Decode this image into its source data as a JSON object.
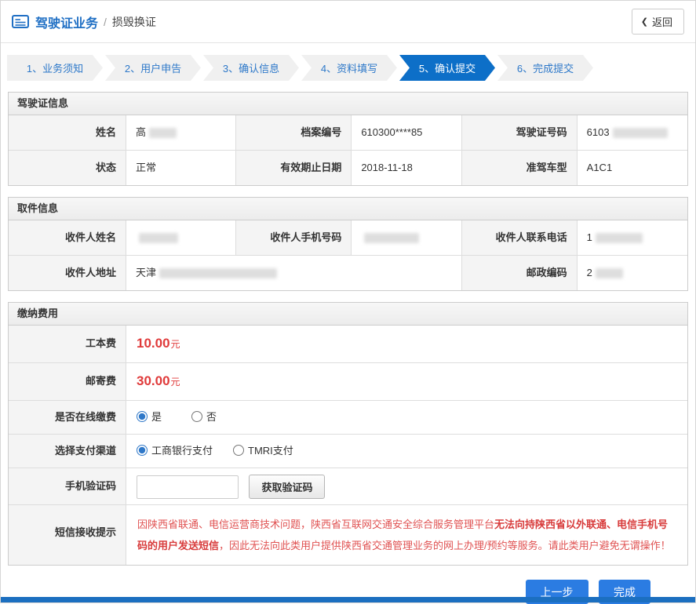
{
  "header": {
    "title": "驾驶证业务",
    "separator": "/",
    "subtitle": "损毁换证",
    "back_label": "返回",
    "back_chevron": "❮"
  },
  "steps": {
    "items": [
      {
        "label": "1、业务须知"
      },
      {
        "label": "2、用户申告"
      },
      {
        "label": "3、确认信息"
      },
      {
        "label": "4、资料填写"
      },
      {
        "label": "5、确认提交"
      },
      {
        "label": "6、完成提交"
      }
    ],
    "active_step": "5、确认提交"
  },
  "license_info": {
    "title": "驾驶证信息",
    "name_label": "姓名",
    "name_value": "高",
    "file_no_label": "档案编号",
    "file_no_value": "610300****85",
    "license_no_label": "驾驶证号码",
    "license_no_value": "6103",
    "status_label": "状态",
    "status_value": "正常",
    "expiry_label": "有效期止日期",
    "expiry_value": "2018-11-18",
    "vehicle_label": "准驾车型",
    "vehicle_value": "A1C1"
  },
  "pickup_info": {
    "title": "取件信息",
    "recipient_name_label": "收件人姓名",
    "recipient_name_value": "",
    "recipient_phone_label": "收件人手机号码",
    "recipient_phone_value": "",
    "contact_phone_label": "收件人联系电话",
    "contact_phone_value": "1",
    "address_label": "收件人地址",
    "address_value": "天津",
    "postcode_label": "邮政编码",
    "postcode_value": "2"
  },
  "fees": {
    "title": "缴纳费用",
    "card_fee_label": "工本费",
    "card_fee_value": "10.00",
    "fee_unit": "元",
    "post_fee_label": "邮寄费",
    "post_fee_value": "30.00",
    "online_pay_label": "是否在线缴费",
    "online_yes_label": "是",
    "online_no_label": "否",
    "channel_label": "选择支付渠道",
    "channel_icbc_label": "工商银行支付",
    "channel_tmri_label": "TMRI支付",
    "sms_code_label": "手机验证码",
    "sms_code_value": "",
    "get_code_label": "获取验证码",
    "sms_tip_label": "短信接收提示",
    "sms_tip_part1": "因陕西省联通、电信运营商技术问题，陕西省互联网交通安全综合服务管理平台",
    "sms_tip_bold": "无法向持陕西省以外联通、电信手机号码的用户发送短信",
    "sms_tip_part2": "，因此无法向此类用户提供陕西省交通管理业务的网上办理/预约等服务。请此类用户避免无谓操作！"
  },
  "footer": {
    "prev_label": "上一步",
    "finish_label": "完成"
  }
}
